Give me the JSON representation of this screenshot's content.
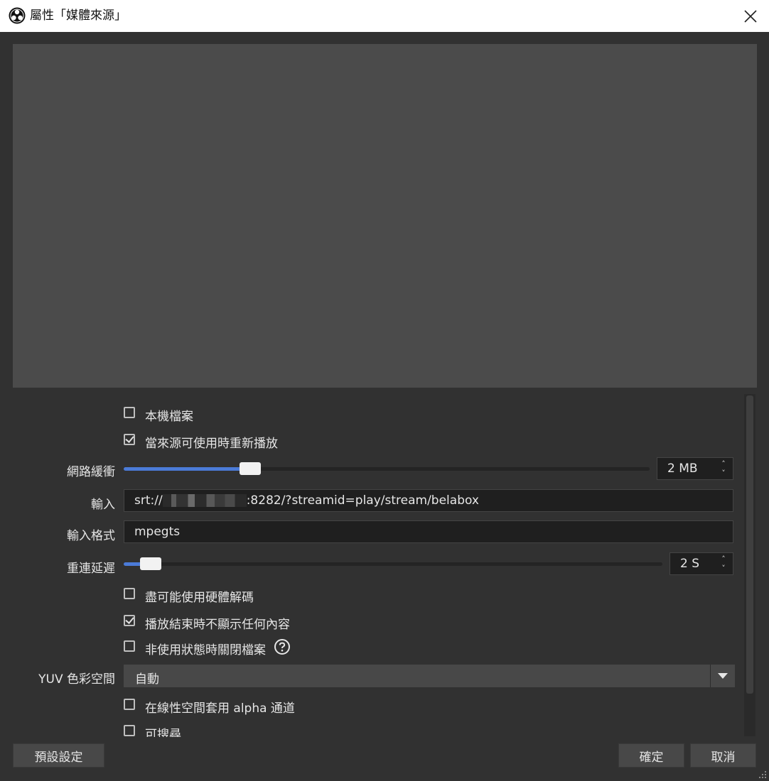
{
  "window": {
    "title": "屬性「媒體來源」"
  },
  "props": {
    "local_file_label": "本機檔案",
    "restart_label": "當來源可使用時重新播放",
    "network_buffer": {
      "label": "網路緩衝",
      "value": "2 MB",
      "percent": 24
    },
    "input": {
      "label": "輸入",
      "prefix": "srt://",
      "suffix": ":8282/?streamid=play/stream/belabox"
    },
    "input_format": {
      "label": "輸入格式",
      "value": "mpegts"
    },
    "reconnect": {
      "label": "重連延遲",
      "value": "2 S",
      "percent": 5
    },
    "hw_decode_label": "盡可能使用硬體解碼",
    "show_nothing_label": "播放結束時不顯示任何內容",
    "close_inactive_label": "非使用狀態時關閉檔案",
    "yuv": {
      "label": "YUV 色彩空間",
      "value": "自動"
    },
    "alpha_label": "在線性空間套用 alpha 通道",
    "seekable_label": "可搜尋"
  },
  "buttons": {
    "defaults": "預設設定",
    "ok": "確定",
    "cancel": "取消"
  }
}
